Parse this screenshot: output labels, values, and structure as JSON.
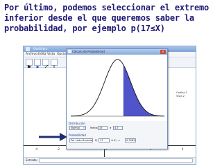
{
  "caption": "Por último, podemos seleccionar el extremo inferior desde el que queremos saber la probabilidad, por ejemplo p(17≤X)",
  "geogebra": {
    "window_title": "GeoGebra",
    "menu": [
      "Archivo",
      "Edita",
      "Vista",
      "Opciones",
      "Herramientas",
      "Ventana",
      "Ayuda"
    ],
    "side_panel": [
      "Gráfica 1",
      "Vista 2"
    ],
    "axis_ticks": [
      "-4",
      "-2",
      "0",
      "2",
      "4"
    ],
    "status_label": "Entrada:",
    "input_value": ""
  },
  "dialog": {
    "title": "Cálculo de Probabilidad",
    "close_label": "✕",
    "distribution_section": "Distribución",
    "distribution_value": "Normal",
    "mean_label": "Media",
    "mean_value": "15",
    "sd_label": "σ",
    "sd_value": "4.5",
    "probability_section": "Probabilidad",
    "probability_type": "Por Lado Derecho",
    "lower_bound_label": "P(",
    "lower_bound_value": "17",
    "upper_label": "≤ X ) =",
    "result_value": "0.3282",
    "result_label": "= 0.7257"
  },
  "chart_data": {
    "type": "area",
    "distribution": "normal",
    "mean": 15,
    "sd": 4.5,
    "shaded_from": 17,
    "shaded_to": 31,
    "curve_color": "#111111",
    "shade_color": "#4f55c8"
  },
  "colors": {
    "caption": "#1f1a73",
    "arrow": "#1f2f6e"
  }
}
